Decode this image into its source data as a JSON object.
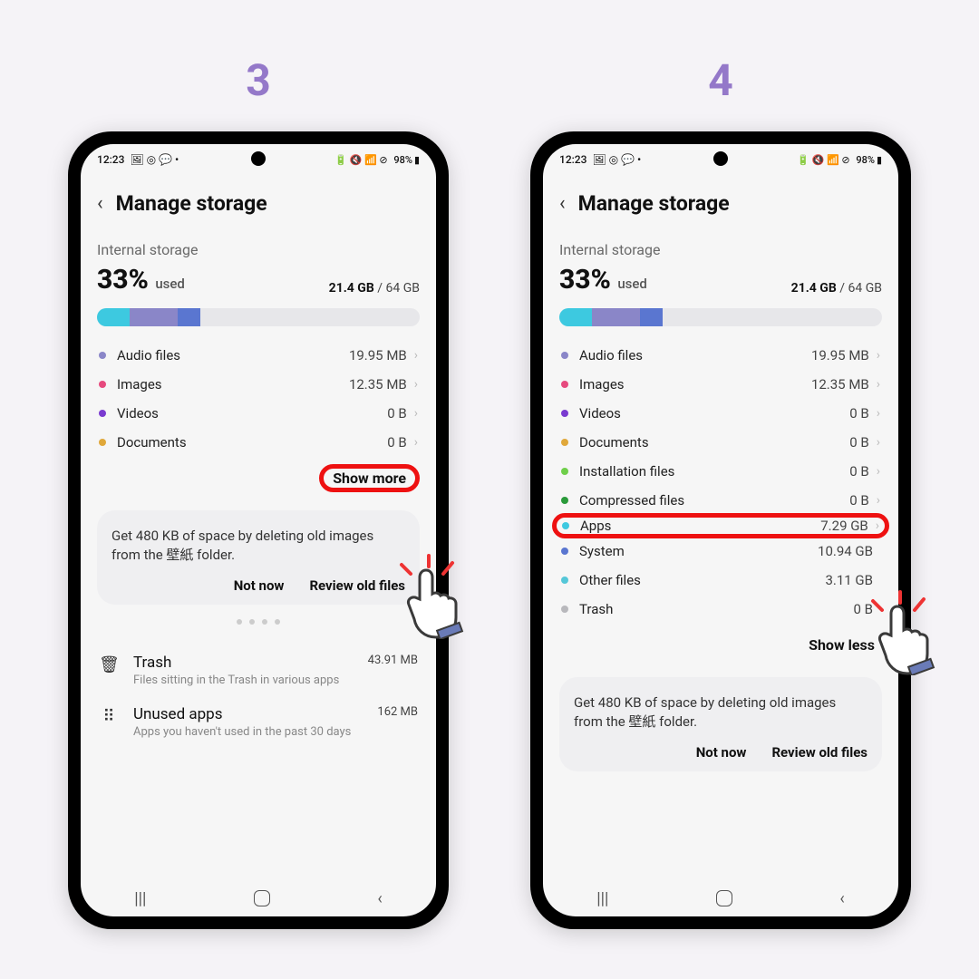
{
  "steps": [
    "3",
    "4"
  ],
  "status": {
    "time": "12:23",
    "icons_left": "🖼 ◎ 💬 •",
    "icons_right": "🔋 🔇 📶 ⊘",
    "battery": "98%"
  },
  "header": {
    "title": "Manage storage"
  },
  "storage": {
    "section_label": "Internal storage",
    "percent": "33%",
    "used_word": "used",
    "used": "21.4 GB",
    "total": "64 GB"
  },
  "bar_segments": [
    {
      "color": "#3dc9e0",
      "width": "10%"
    },
    {
      "color": "#8a86c8",
      "width": "15%"
    },
    {
      "color": "#5a76d0",
      "width": "7%"
    }
  ],
  "rows_short": [
    {
      "dot": "#8a86c8",
      "label": "Audio files",
      "size": "19.95 MB",
      "chev": true
    },
    {
      "dot": "#e64a7e",
      "label": "Images",
      "size": "12.35 MB",
      "chev": true
    },
    {
      "dot": "#7a3bd0",
      "label": "Videos",
      "size": "0 B",
      "chev": true
    },
    {
      "dot": "#e0a83a",
      "label": "Documents",
      "size": "0 B",
      "chev": true
    }
  ],
  "rows_long": [
    {
      "dot": "#8a86c8",
      "label": "Audio files",
      "size": "19.95 MB",
      "chev": true
    },
    {
      "dot": "#e64a7e",
      "label": "Images",
      "size": "12.35 MB",
      "chev": true
    },
    {
      "dot": "#7a3bd0",
      "label": "Videos",
      "size": "0 B",
      "chev": true
    },
    {
      "dot": "#e0a83a",
      "label": "Documents",
      "size": "0 B",
      "chev": true
    },
    {
      "dot": "#6fcf4a",
      "label": "Installation files",
      "size": "0 B",
      "chev": true
    },
    {
      "dot": "#2a9a3a",
      "label": "Compressed files",
      "size": "0 B",
      "chev": true
    },
    {
      "dot": "#3dc9e0",
      "label": "Apps",
      "size": "7.29 GB",
      "chev": true,
      "hl": true
    },
    {
      "dot": "#5a76d0",
      "label": "System",
      "size": "10.94 GB",
      "chev": false
    },
    {
      "dot": "#55c7d8",
      "label": "Other files",
      "size": "3.11 GB",
      "chev": false
    },
    {
      "dot": "#b8b8bc",
      "label": "Trash",
      "size": "0 B",
      "chev": false
    }
  ],
  "show_more": "Show more",
  "show_less": "Show less",
  "card": {
    "text": "Get 480 KB of space by deleting old images from the 壁紙 folder.",
    "not_now": "Not now",
    "review": "Review old files"
  },
  "extras": [
    {
      "icon": "🗑",
      "title": "Trash",
      "size": "43.91 MB",
      "sub": "Files sitting in the Trash in various apps"
    },
    {
      "icon": "⠿",
      "title": "Unused apps",
      "size": "162 MB",
      "sub": "Apps you haven't used in the past 30 days"
    }
  ]
}
